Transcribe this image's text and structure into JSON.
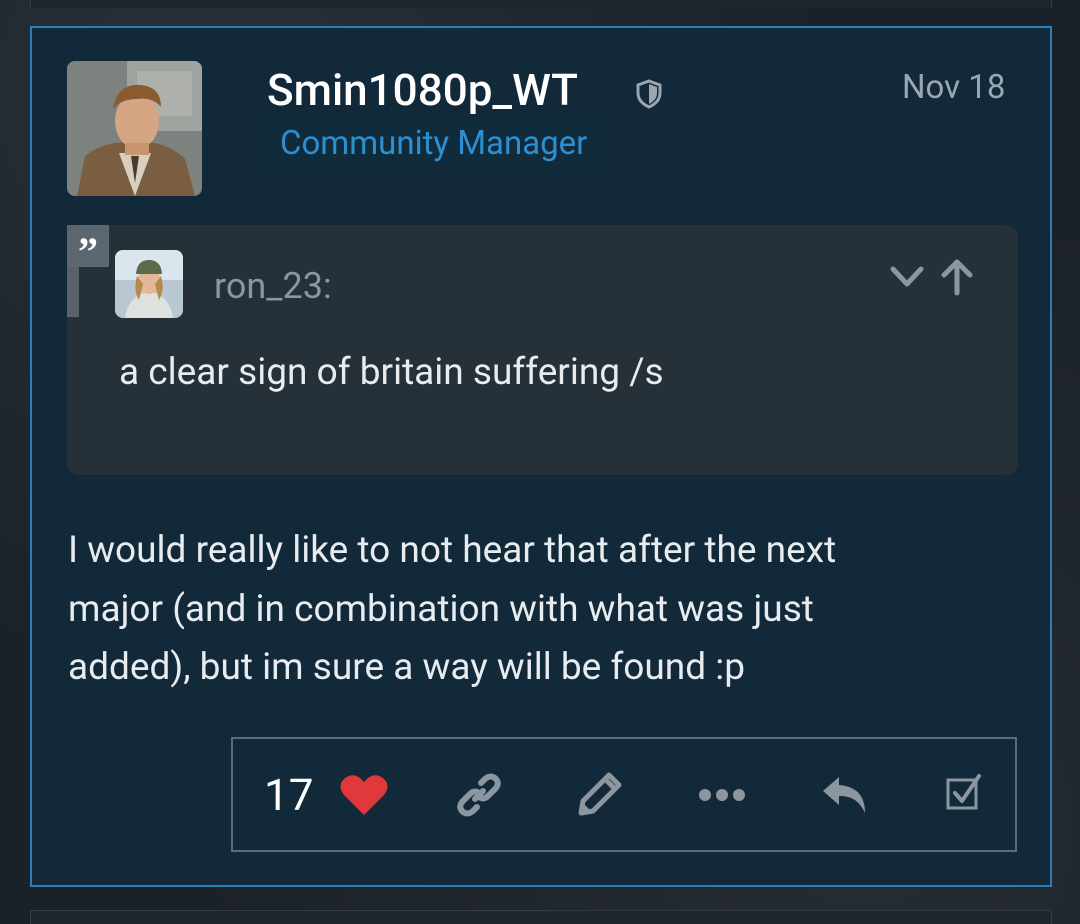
{
  "post": {
    "username": "Smin1080p_WT",
    "role": "Community Manager",
    "date": "Nov 18",
    "quote": {
      "user": "ron_23:",
      "text": "a clear sign of britain suffering /s"
    },
    "body_lines": [
      "I would really like to not hear that after the next",
      "major (and in combination with what was just",
      "added), but im sure a way will be found :p"
    ],
    "likes": "17",
    "icons": [
      "shield-icon",
      "quote-icon",
      "chevron-down-icon",
      "arrow-up-icon",
      "heart-icon",
      "link-icon",
      "pencil-icon",
      "more-icon",
      "reply-icon",
      "checkbox-icon"
    ]
  },
  "colors": {
    "accent": "#2b7fb8",
    "role": "#2d8fd0",
    "heart": "#e0383b",
    "icon": "#8c969e"
  }
}
